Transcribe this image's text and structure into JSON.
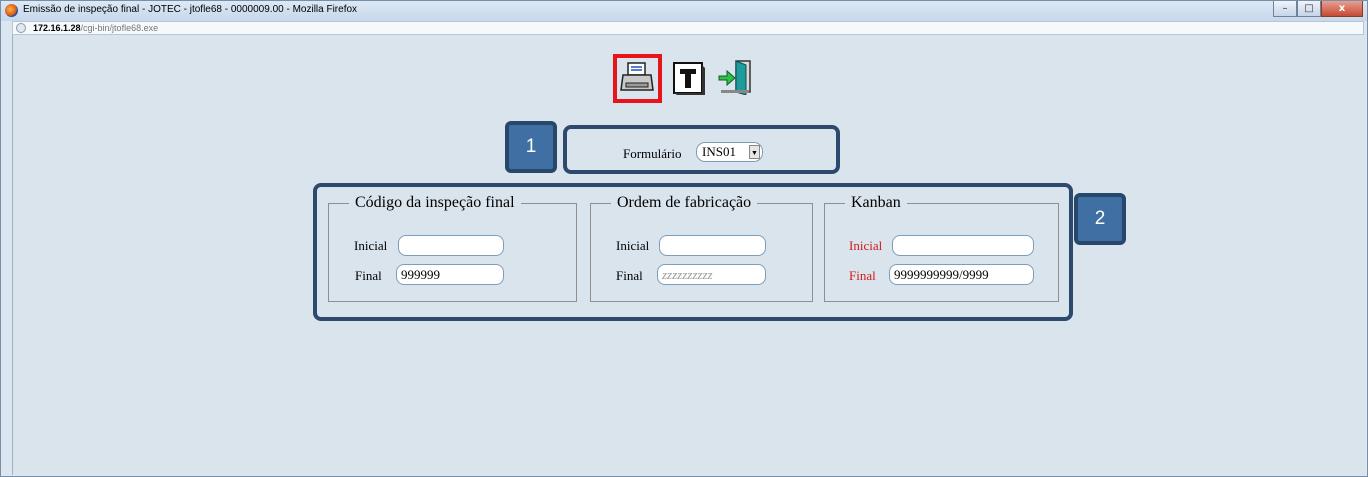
{
  "window": {
    "title": "Emissão de inspeção final - JOTEC - jtofle68 - 0000009.00 - Mozilla Firefox",
    "controls": {
      "minimize": "–",
      "maximize": "□",
      "close": "x"
    }
  },
  "address_bar": {
    "host": "172.16.1.28",
    "path": "/cgi-bin/jtofle68.exe"
  },
  "toolbar": {
    "print_icon": "printer-icon",
    "text_icon": "text-T-icon",
    "exit_icon": "exit-door-icon"
  },
  "annotations": {
    "badge1": "1",
    "badge2": "2"
  },
  "form": {
    "formulario_label": "Formulário",
    "formulario_value": "INS01"
  },
  "groups": {
    "codigo": {
      "legend": "Código da inspeção final",
      "inicial_label": "Inicial",
      "inicial_value": "",
      "final_label": "Final",
      "final_value": "999999"
    },
    "ordem": {
      "legend": "Ordem de fabricação",
      "inicial_label": "Inicial",
      "inicial_value": "",
      "final_label": "Final",
      "final_placeholder": "zzzzzzzzzz"
    },
    "kanban": {
      "legend": "Kanban",
      "inicial_label": "Inicial",
      "inicial_value": "",
      "final_label": "Final",
      "final_value": "9999999999/9999"
    }
  },
  "colors": {
    "highlight_red": "#e8141c",
    "callout_dark": "#2d4a6e",
    "badge_blue": "#3f6fa3",
    "required_red": "#d31a1a"
  }
}
